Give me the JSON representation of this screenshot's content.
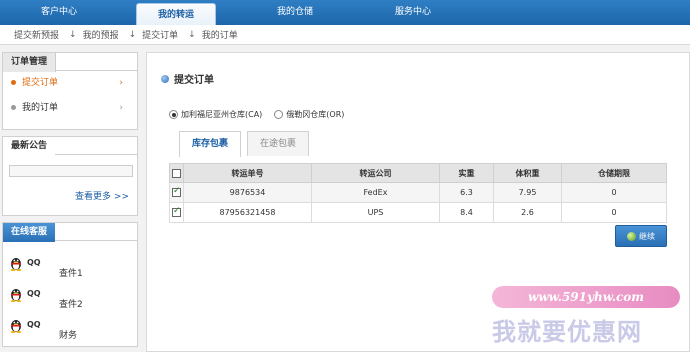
{
  "topnav": {
    "tabs": [
      {
        "label": "客户中心"
      },
      {
        "label": "我的转运"
      },
      {
        "label": "我的仓储"
      },
      {
        "label": "服务中心"
      }
    ]
  },
  "subnav": {
    "links": [
      "提交新预报",
      "我的预报",
      "提交订单",
      "我的订单"
    ],
    "arrow": "↓"
  },
  "sidebar": {
    "order_title": "订单管理",
    "menu": [
      {
        "label": "提交订单",
        "chev": "›"
      },
      {
        "label": "我的订单",
        "chev": "›"
      }
    ],
    "notice_title": "最新公告",
    "more_label": "查看更多 >>",
    "service_title": "在线客服",
    "service": [
      {
        "qq": "QQ",
        "name": "查件1"
      },
      {
        "qq": "QQ",
        "name": "查件2"
      },
      {
        "qq": "QQ",
        "name": "财务"
      }
    ]
  },
  "main": {
    "title": "提交订单",
    "radios": [
      {
        "label": "加利福尼亚州仓库(CA)",
        "checked": true
      },
      {
        "label": "俄勒冈仓库(OR)",
        "checked": false
      }
    ],
    "tabs": [
      "库存包裹",
      "在途包裹"
    ],
    "table": {
      "headers": [
        "转运单号",
        "转运公司",
        "实重",
        "体积重",
        "仓储期限"
      ],
      "rows": [
        [
          "9876534",
          "FedEx",
          "6.3",
          "7.95",
          "0"
        ],
        [
          "87956321458",
          "UPS",
          "8.4",
          "2.6",
          "0"
        ]
      ]
    },
    "continue_label": "继续"
  },
  "watermark": {
    "url": "www.591yhw.com",
    "text": "我就要优惠网"
  },
  "colors": {
    "nav_blue": "#1d66aa",
    "accent_orange": "#e06b10",
    "link_blue": "#1b5fa3"
  }
}
